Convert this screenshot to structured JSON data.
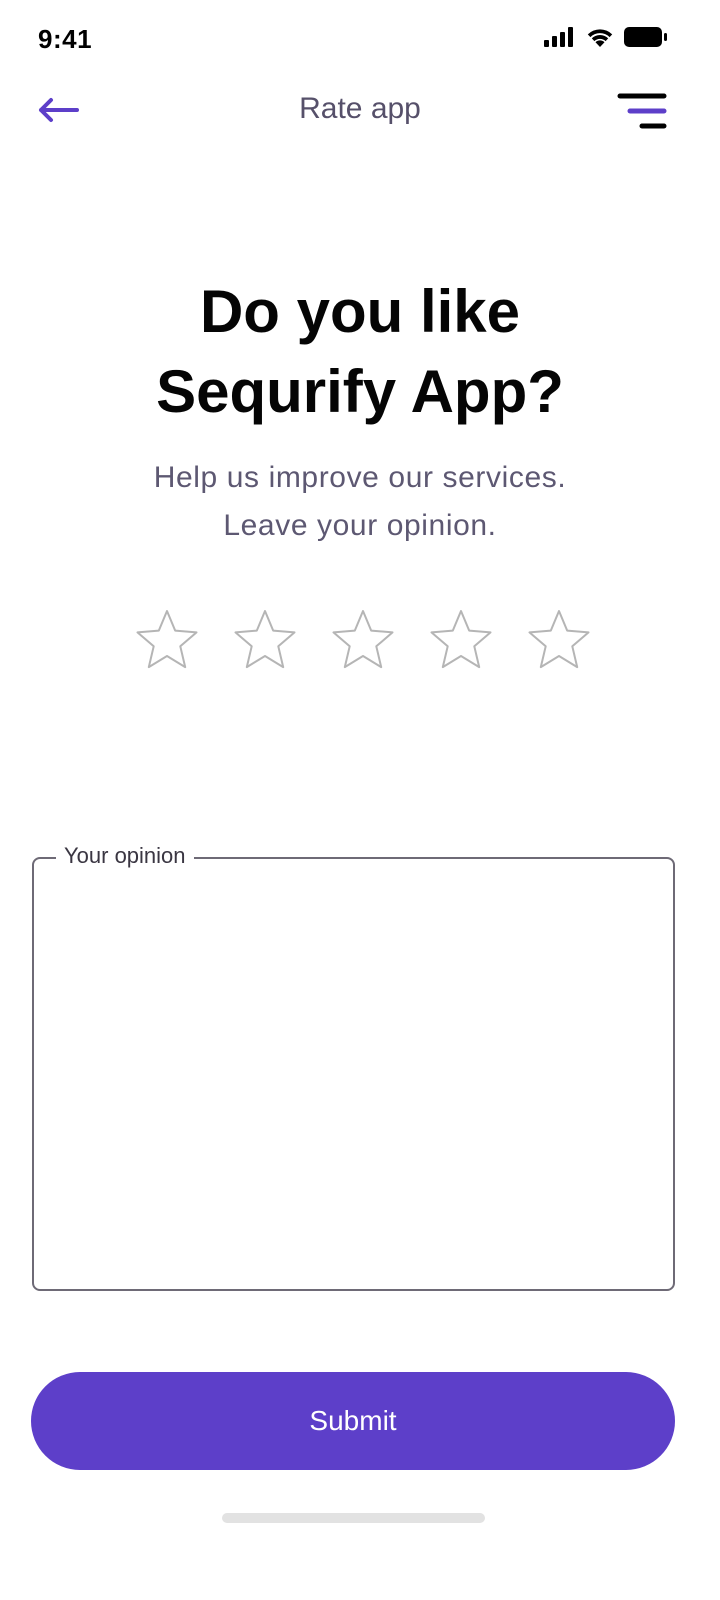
{
  "status_bar": {
    "time": "9:41",
    "icons": [
      "cellular-signal-icon",
      "wifi-icon",
      "battery-icon"
    ]
  },
  "header": {
    "title": "Rate app",
    "back_icon": "arrow-left-icon",
    "menu_icon": "menu-icon"
  },
  "hero": {
    "headline_line1": "Do you like",
    "headline_line2": "Sequrify App?",
    "subtitle_line1": "Help us improve our services.",
    "subtitle_line2": "Leave your opinion."
  },
  "rating": {
    "max": 5,
    "selected": 0
  },
  "opinion": {
    "label": "Your opinion",
    "value": ""
  },
  "submit": {
    "label": "Submit"
  },
  "colors": {
    "accent": "#5D3FC9",
    "title_text": "#56506A",
    "body_text": "#5D5872",
    "star_outline": "#B5B5B5"
  }
}
